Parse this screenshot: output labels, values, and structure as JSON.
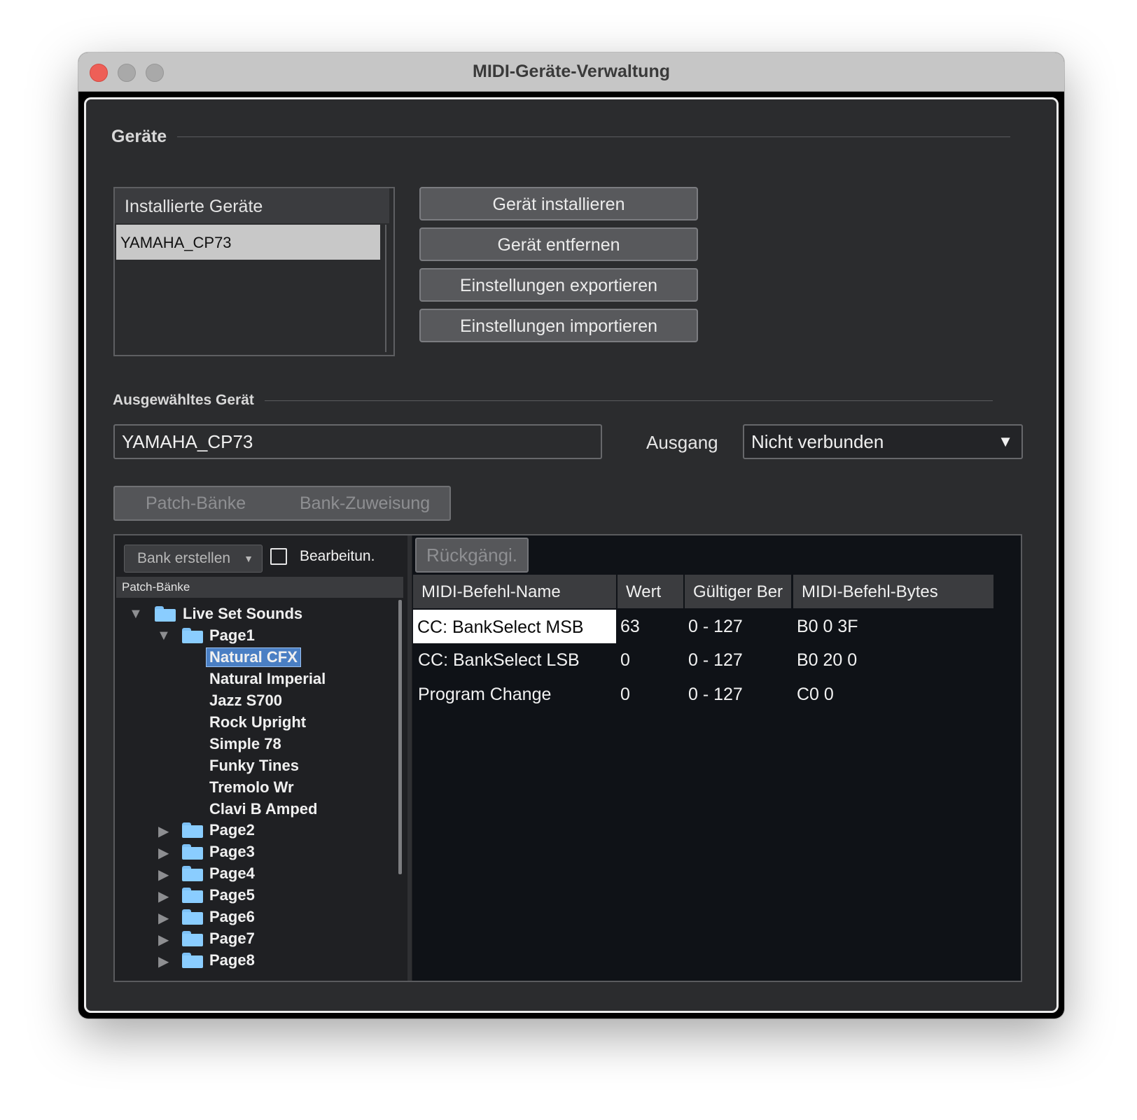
{
  "window": {
    "title": "MIDI-Geräte-Verwaltung"
  },
  "devices": {
    "group_title": "Geräte",
    "list_header": "Installierte Geräte",
    "installed": [
      "YAMAHA_CP73"
    ],
    "buttons": {
      "install": "Gerät installieren",
      "remove": "Gerät entfernen",
      "export": "Einstellungen exportieren",
      "import": "Einstellungen importieren"
    }
  },
  "selected_device": {
    "group_title": "Ausgewähltes Gerät",
    "name": "YAMAHA_CP73",
    "output_label": "Ausgang",
    "output_value": "Nicht verbunden"
  },
  "tabs": [
    "Patch-Bänke",
    "Bank-Zuweisung"
  ],
  "bank_panel": {
    "create_bank": "Bank erstellen",
    "edit_label": "Bearbeitun.",
    "header": "Patch-Bänke",
    "root": "Live Set Sounds",
    "page1": "Page1",
    "patches": [
      "Natural CFX",
      "Natural Imperial",
      "Jazz S700",
      "Rock Upright",
      "Simple 78",
      "Funky Tines",
      "Tremolo Wr",
      "Clavi B Amped"
    ],
    "pages": [
      "Page2",
      "Page3",
      "Page4",
      "Page5",
      "Page6",
      "Page7",
      "Page8"
    ]
  },
  "command_table": {
    "undo": "Rückgängi.",
    "columns": [
      "MIDI-Befehl-Name",
      "Wert",
      "Gültiger Ber",
      "MIDI-Befehl-Bytes"
    ],
    "rows": [
      [
        "CC: BankSelect MSB",
        "63",
        "0 - 127",
        "B0 0 3F"
      ],
      [
        "CC: BankSelect LSB",
        "0",
        "0 - 127",
        "B0 20 0"
      ],
      [
        "Program Change",
        "0",
        "0 - 127",
        "C0 0"
      ]
    ]
  }
}
